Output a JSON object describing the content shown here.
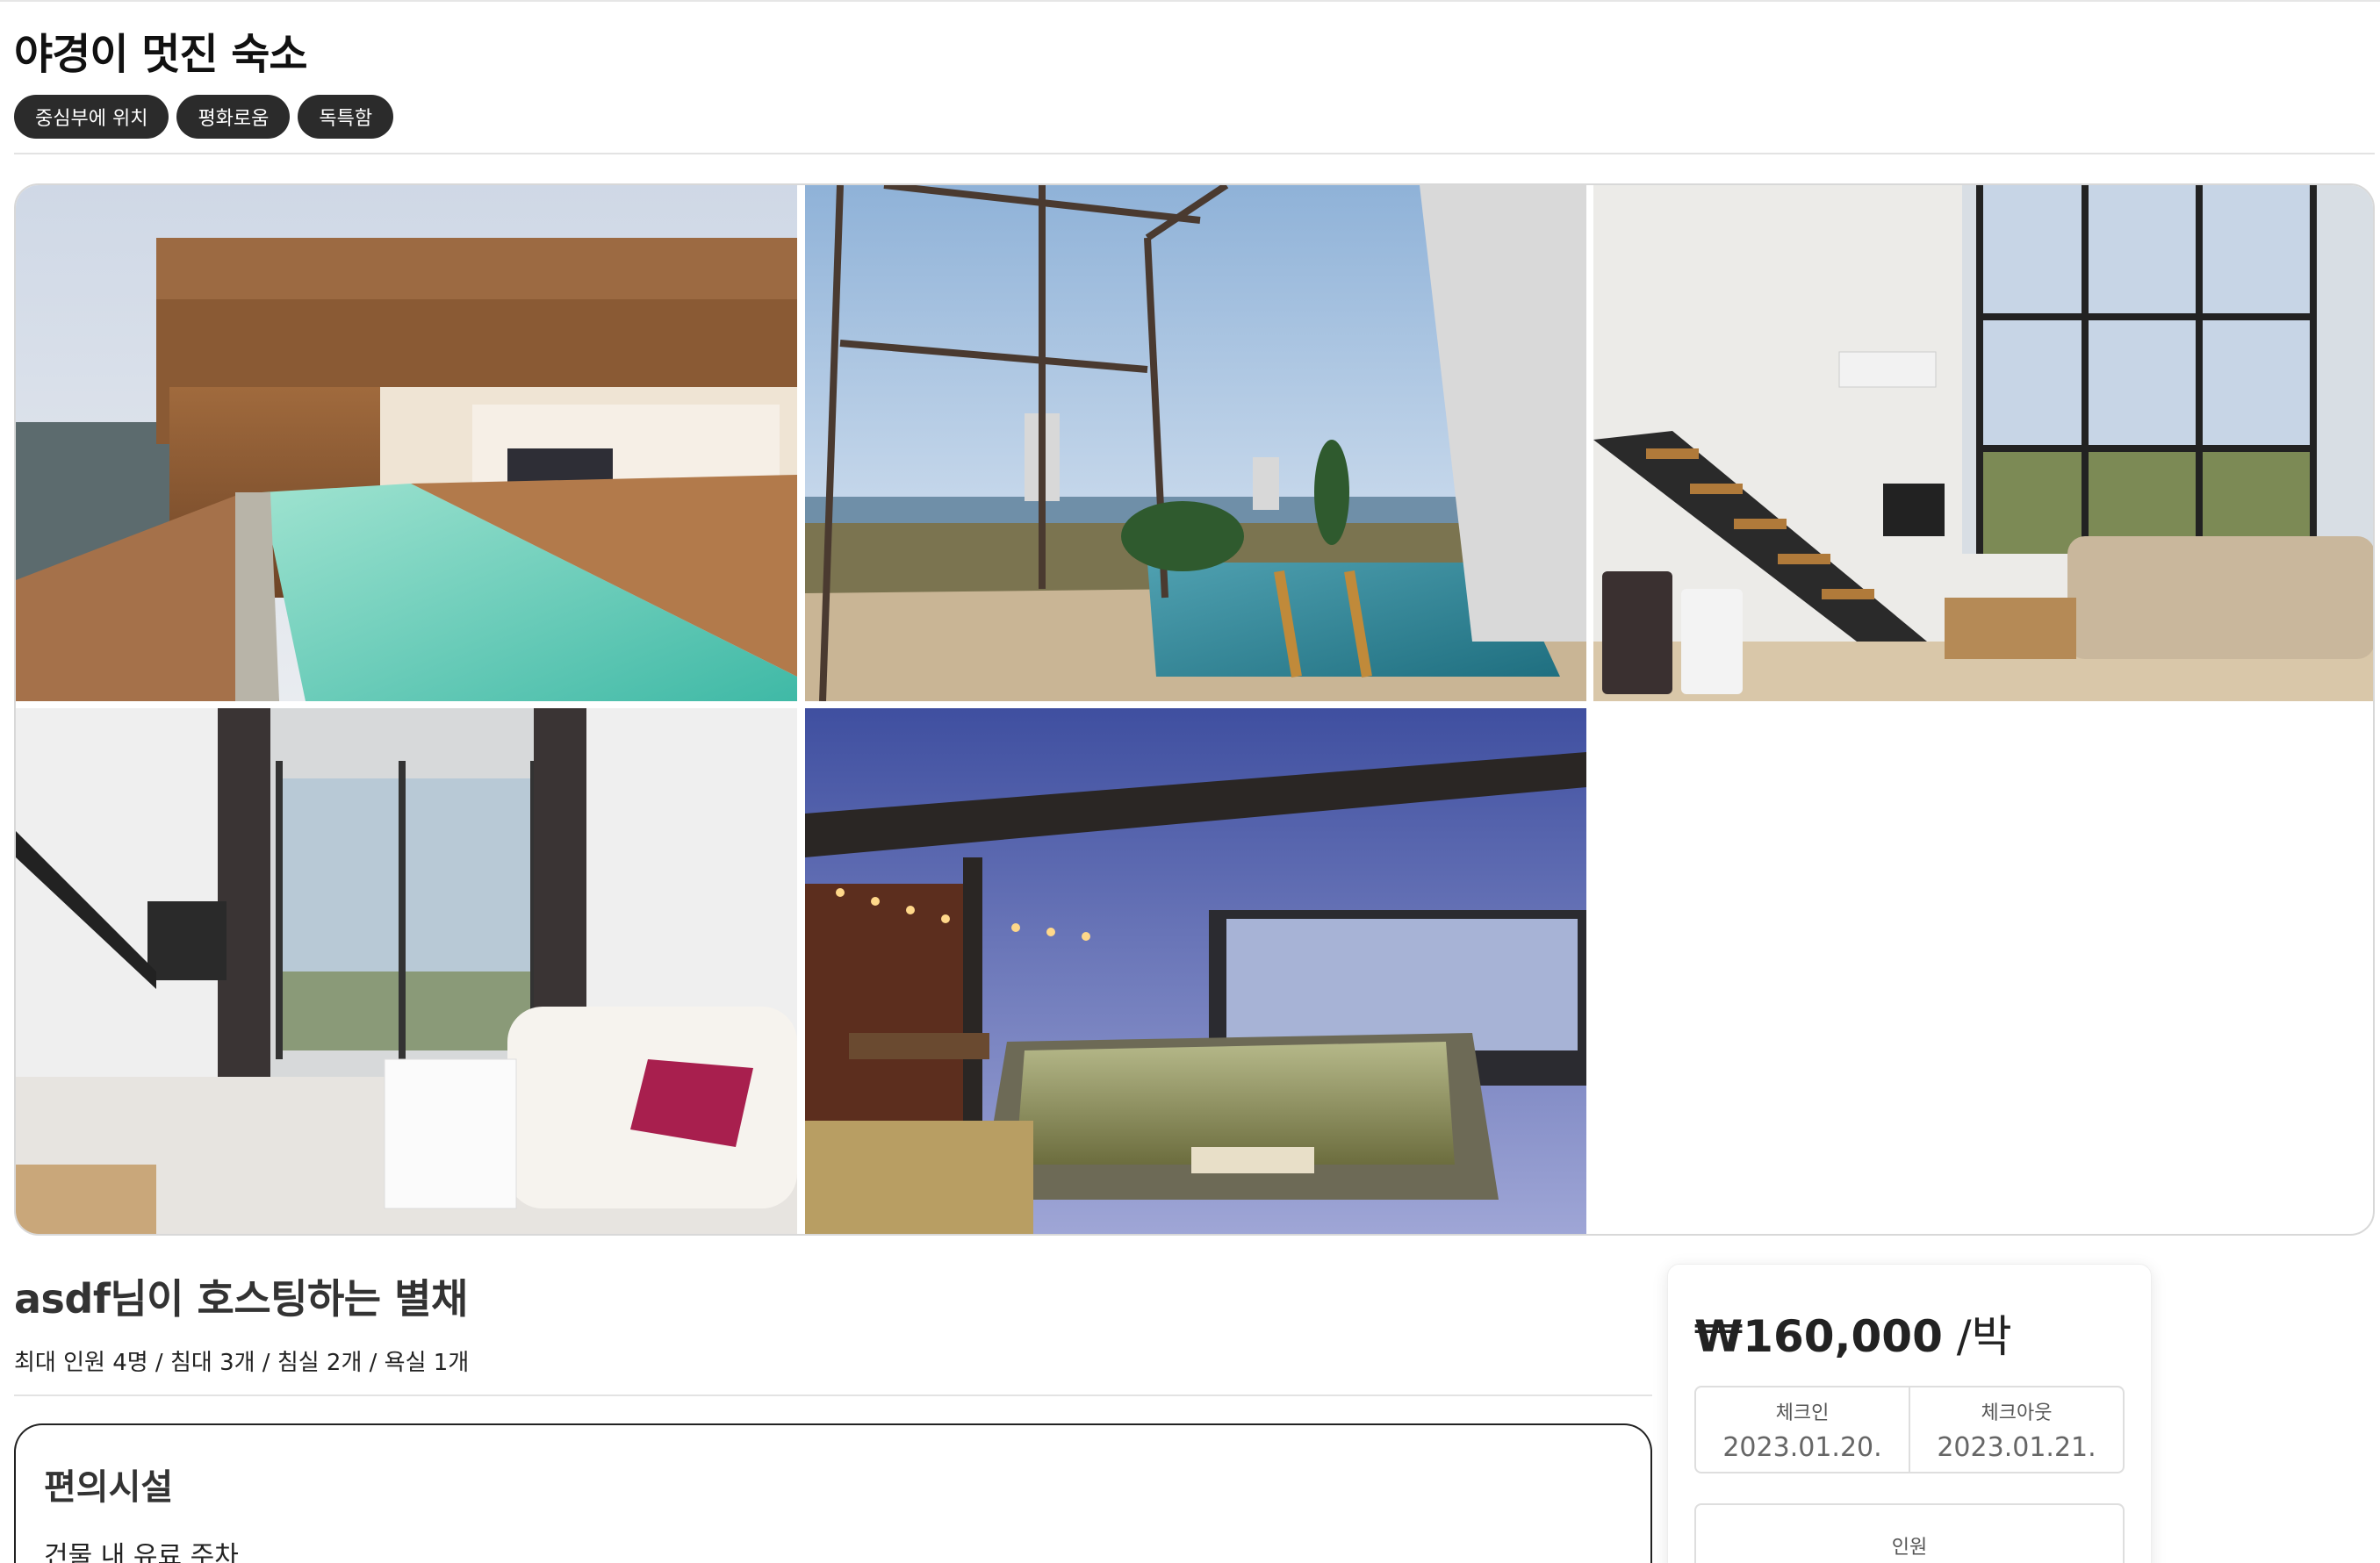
{
  "listing": {
    "title": "야경이 멋진 숙소",
    "tags": [
      "중심부에 위치",
      "평화로움",
      "독특함"
    ]
  },
  "gallery": {
    "photos": [
      {
        "name": "photo-pool-deck"
      },
      {
        "name": "photo-sea-view-pool"
      },
      {
        "name": "photo-loft-living-room"
      },
      {
        "name": "photo-white-living-room"
      },
      {
        "name": "photo-night-jacuzzi"
      }
    ]
  },
  "details": {
    "host_title": "asdf님이 호스팅하는 별채",
    "capacity": "최대 인원 4명 / 침대 3개 / 침실 2개 / 욕실 1개"
  },
  "amenities": {
    "title": "편의시설",
    "items": [
      "건물 내 유료 주차"
    ]
  },
  "booking": {
    "price": "₩160,000",
    "unit": " /박",
    "checkin_label": "체크인",
    "checkin_value": "2023.01.20.",
    "checkout_label": "체크아웃",
    "checkout_value": "2023.01.21.",
    "guests_label": "인원"
  }
}
